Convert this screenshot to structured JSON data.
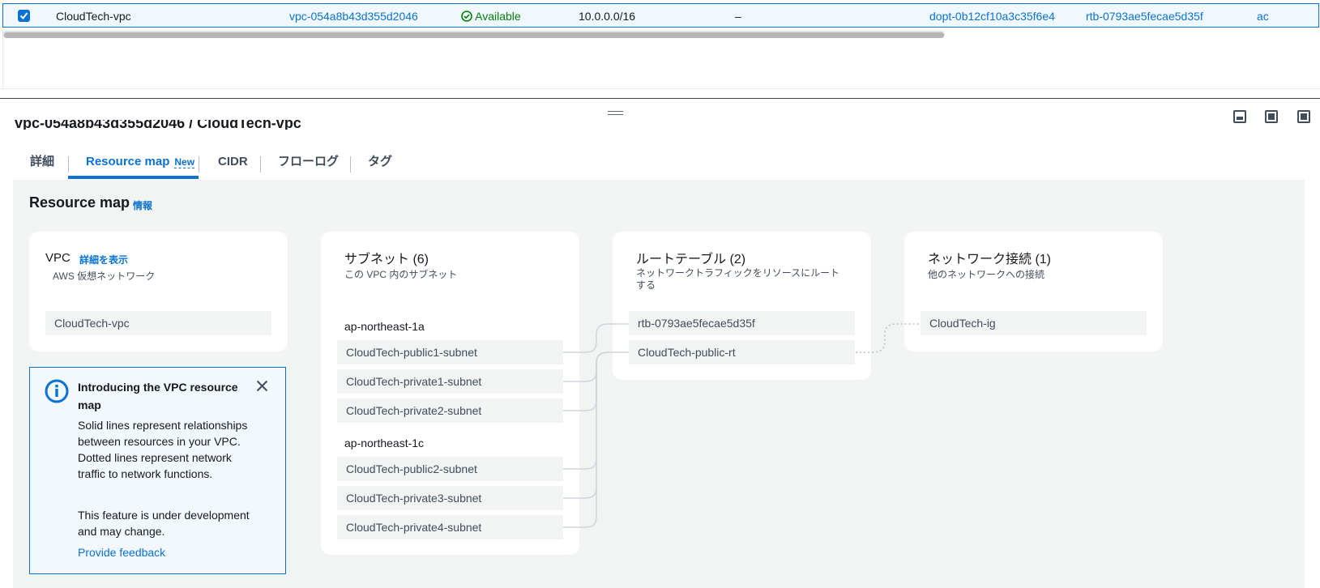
{
  "table_row": {
    "name": "CloudTech-vpc",
    "vpc_id": "vpc-054a8b43d355d2046",
    "state": "Available",
    "cidr": "10.0.0.0/16",
    "ipv6": "–",
    "dhcp_options": "dopt-0b12cf10a3c35f6e4",
    "route_table": "rtb-0793ae5fecae5d35f",
    "truncated_link": "ac"
  },
  "details_header": {
    "cut_title": "vpc-054a8b43d355d2046 / CloudTech-vpc"
  },
  "tabs": [
    {
      "label": "詳細"
    },
    {
      "label": "Resource map",
      "badge": "New"
    },
    {
      "label": "CIDR"
    },
    {
      "label": "フローログ"
    },
    {
      "label": "タグ"
    }
  ],
  "resource_map": {
    "title": "Resource map",
    "info_link": "情報",
    "vpc_card": {
      "title": "VPC",
      "details_link": "詳細を表示",
      "subtitle": "AWS 仮想ネットワーク",
      "items": [
        "CloudTech-vpc"
      ]
    },
    "subnets_card": {
      "title": "サブネット (6)",
      "subtitle": "この VPC 内のサブネット",
      "zones": [
        {
          "name": "ap-northeast-1a",
          "subnets": [
            "CloudTech-public1-subnet",
            "CloudTech-private1-subnet",
            "CloudTech-private2-subnet"
          ]
        },
        {
          "name": "ap-northeast-1c",
          "subnets": [
            "CloudTech-public2-subnet",
            "CloudTech-private3-subnet",
            "CloudTech-private4-subnet"
          ]
        }
      ]
    },
    "route_tables_card": {
      "title": "ルートテーブル (2)",
      "subtitle_line1": "ネットワークトラフィックをリソースにルート",
      "subtitle_line2": "する",
      "items": [
        "rtb-0793ae5fecae5d35f",
        "CloudTech-public-rt"
      ]
    },
    "network_card": {
      "title": "ネットワーク接続 (1)",
      "subtitle": "他のネットワークへの接続",
      "items": [
        "CloudTech-ig"
      ]
    }
  },
  "alert": {
    "title": "Introducing the VPC resource map",
    "body1": "Solid lines represent relationships between resources in your VPC. Dotted lines represent network traffic to network functions.",
    "body2": "This feature is under development and may change.",
    "link": "Provide feedback"
  },
  "colors": {
    "link": "#0972d3",
    "success": "#037f0c",
    "map_background": "#f2f3f3"
  },
  "icons": [
    "checkbox-checked-icon",
    "status-available-icon",
    "drag-handle-icon",
    "panel-bottom-icon",
    "panel-side-icon",
    "panel-full-icon",
    "info-icon",
    "close-icon"
  ]
}
